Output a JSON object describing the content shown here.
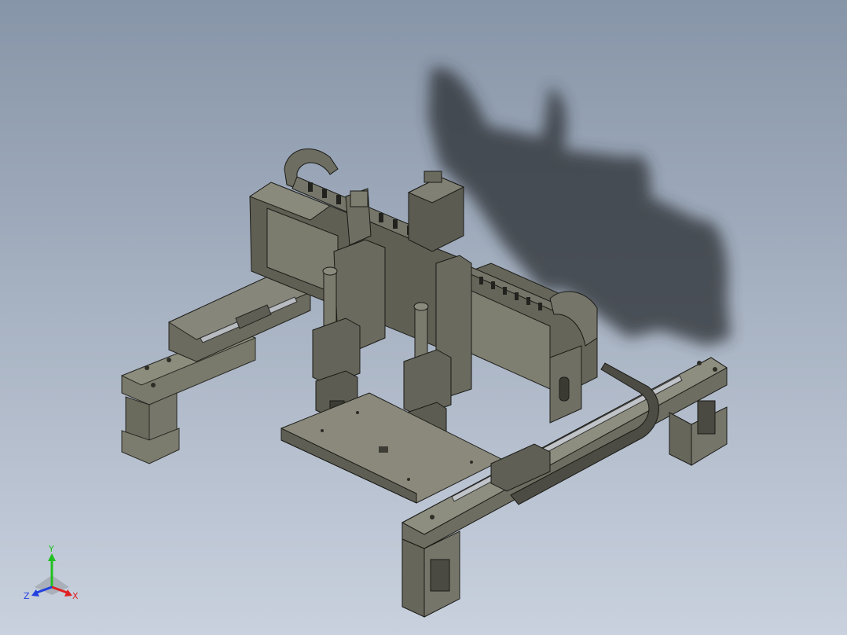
{
  "view": {
    "background_top": "#8795a8",
    "background_bottom": "#c9d1de"
  },
  "model": {
    "body_color": "#6f6e63",
    "shadow_color": "#2b2e33"
  },
  "triad": {
    "x_label": "X",
    "y_label": "Y",
    "z_label": "Z",
    "x_color": "#e02020",
    "y_color": "#20c020",
    "z_color": "#2040e0"
  }
}
